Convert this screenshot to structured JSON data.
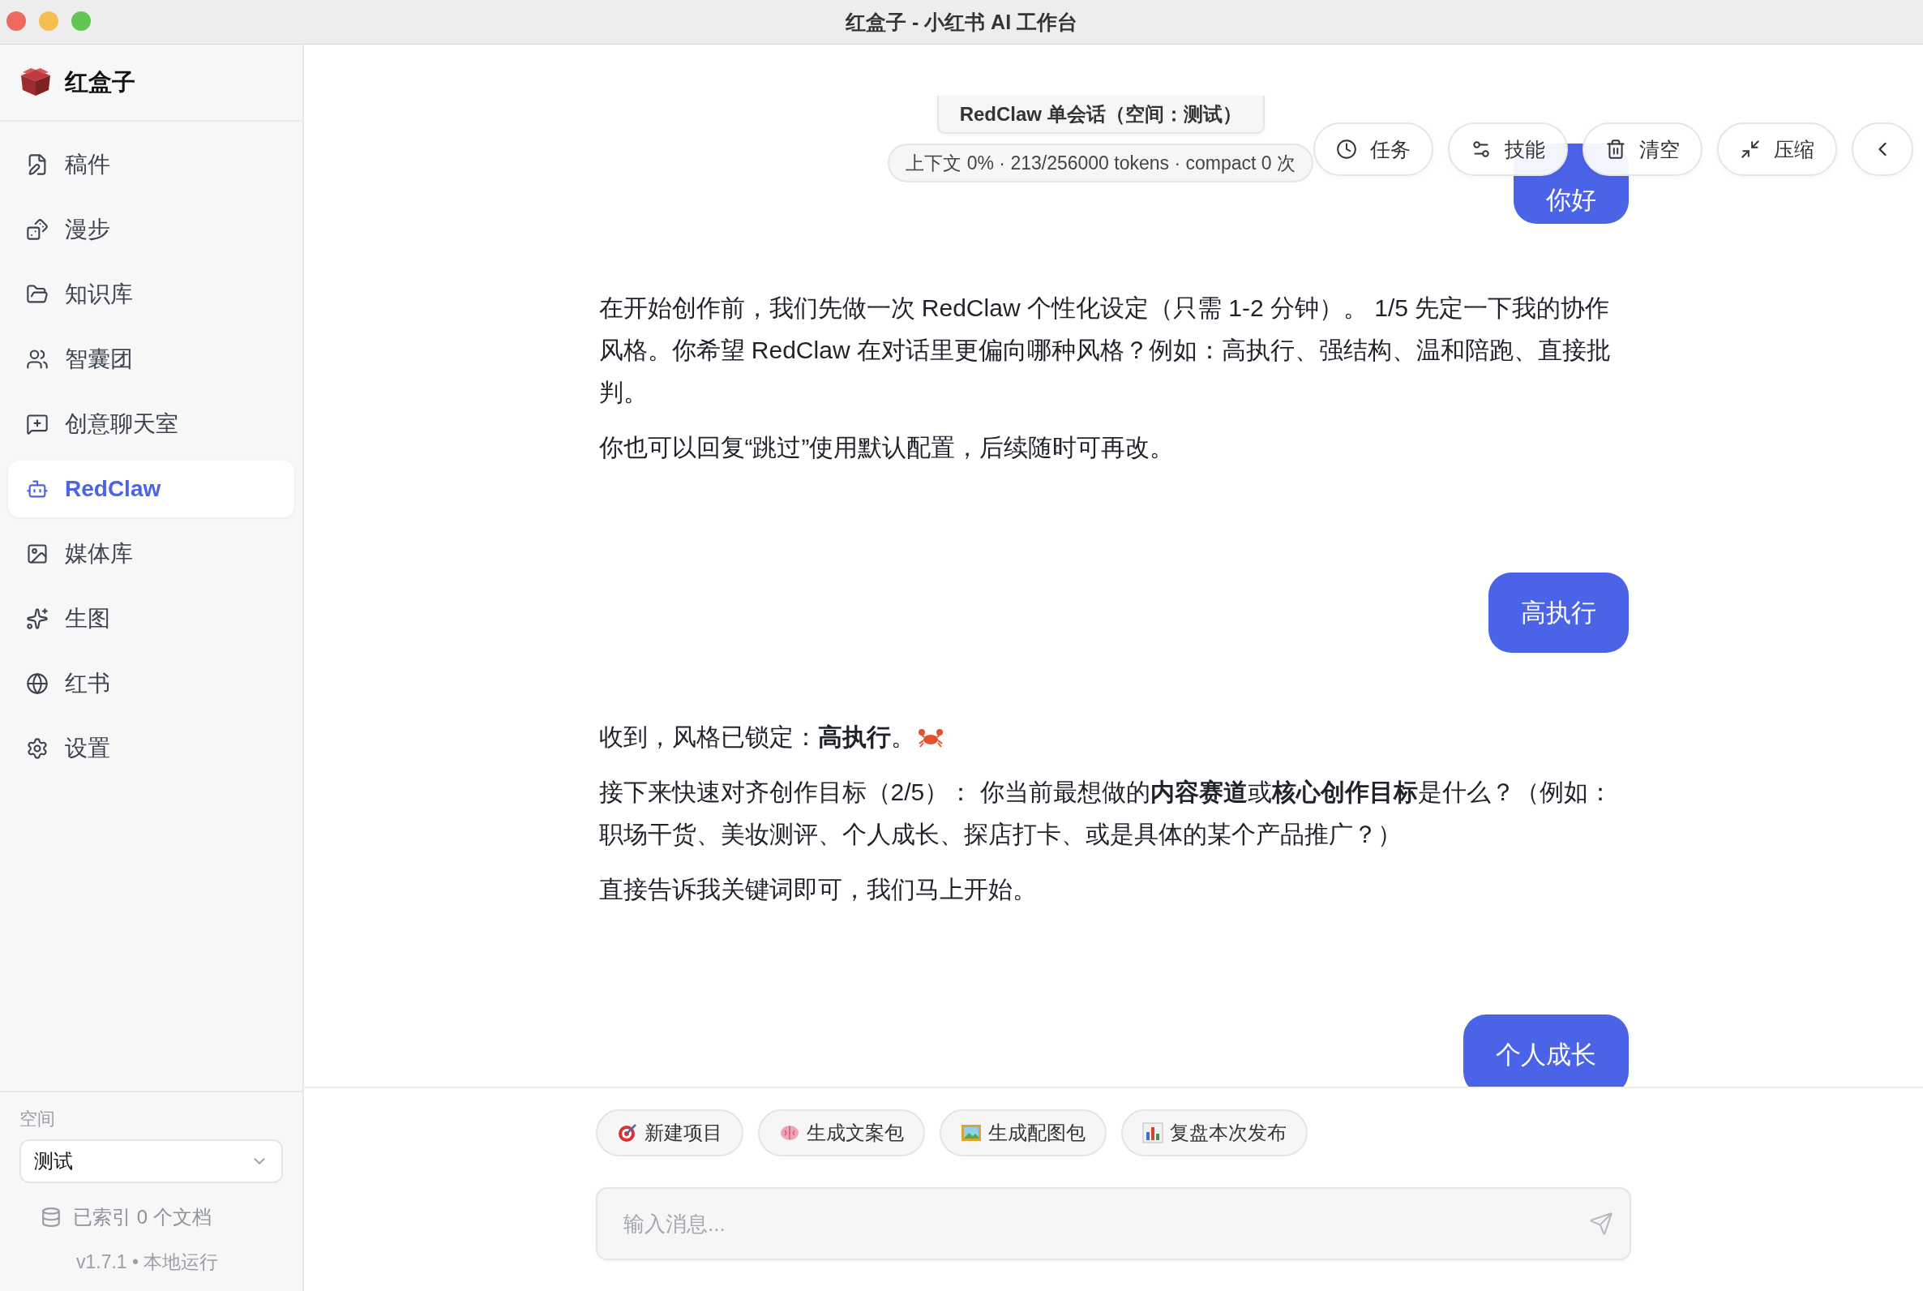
{
  "window": {
    "title": "红盒子 - 小红书 AI 工作台"
  },
  "sidebar": {
    "app_name": "红盒子",
    "items": [
      {
        "label": "稿件",
        "selected": false
      },
      {
        "label": "漫步",
        "selected": false
      },
      {
        "label": "知识库",
        "selected": false
      },
      {
        "label": "智囊团",
        "selected": false
      },
      {
        "label": "创意聊天室",
        "selected": false
      },
      {
        "label": "RedClaw",
        "selected": true
      },
      {
        "label": "媒体库",
        "selected": false
      },
      {
        "label": "生图",
        "selected": false
      },
      {
        "label": "红书",
        "selected": false
      },
      {
        "label": "设置",
        "selected": false
      }
    ],
    "space": {
      "label": "空间",
      "value": "测试"
    },
    "index_status": "已索引 0 个文档",
    "version": "v1.7.1 • 本地运行"
  },
  "session": {
    "title": "RedClaw 单会话（空间：测试）",
    "context": "上下文 0% · 213/256000 tokens · compact 0 次",
    "actions": [
      {
        "label": "任务"
      },
      {
        "label": "技能"
      },
      {
        "label": "清空"
      },
      {
        "label": "压缩"
      }
    ]
  },
  "messages": [
    {
      "kind": "user",
      "text": "你好"
    },
    {
      "kind": "assistant",
      "paragraphs": [
        {
          "text": "在开始创作前，我们先做一次 RedClaw 个性化设定（只需 1-2 分钟）。 1/5 先定一下我的协作风格。你希望 RedClaw 在对话里更偏向哪种风格？例如：高执行、强结构、温和陪跑、直接批判。"
        },
        {
          "text": "你也可以回复“跳过”使用默认配置，后续随时可再改。"
        }
      ]
    },
    {
      "kind": "user",
      "text": "高执行"
    },
    {
      "kind": "assistant",
      "paragraphs": [
        {
          "text": "收到，风格已锁定：**高执行**。",
          "has_icon": true
        },
        {
          "text": "接下来快速对齐创作目标（2/5）：  你当前最想做的**内容赛道**或**核心创作目标**是什么？（例如：职场干货、美妆测评、个人成长、探店打卡、或是具体的某个产品推广？）"
        },
        {
          "text": "直接告诉我关键词即可，我们马上开始。"
        }
      ]
    },
    {
      "kind": "user",
      "text": "个人成长"
    }
  ],
  "quick_actions": [
    {
      "label": "新建项目"
    },
    {
      "label": "生成文案包"
    },
    {
      "label": "生成配图包"
    },
    {
      "label": "复盘本次发布"
    }
  ],
  "composer": {
    "placeholder": "输入消息..."
  }
}
